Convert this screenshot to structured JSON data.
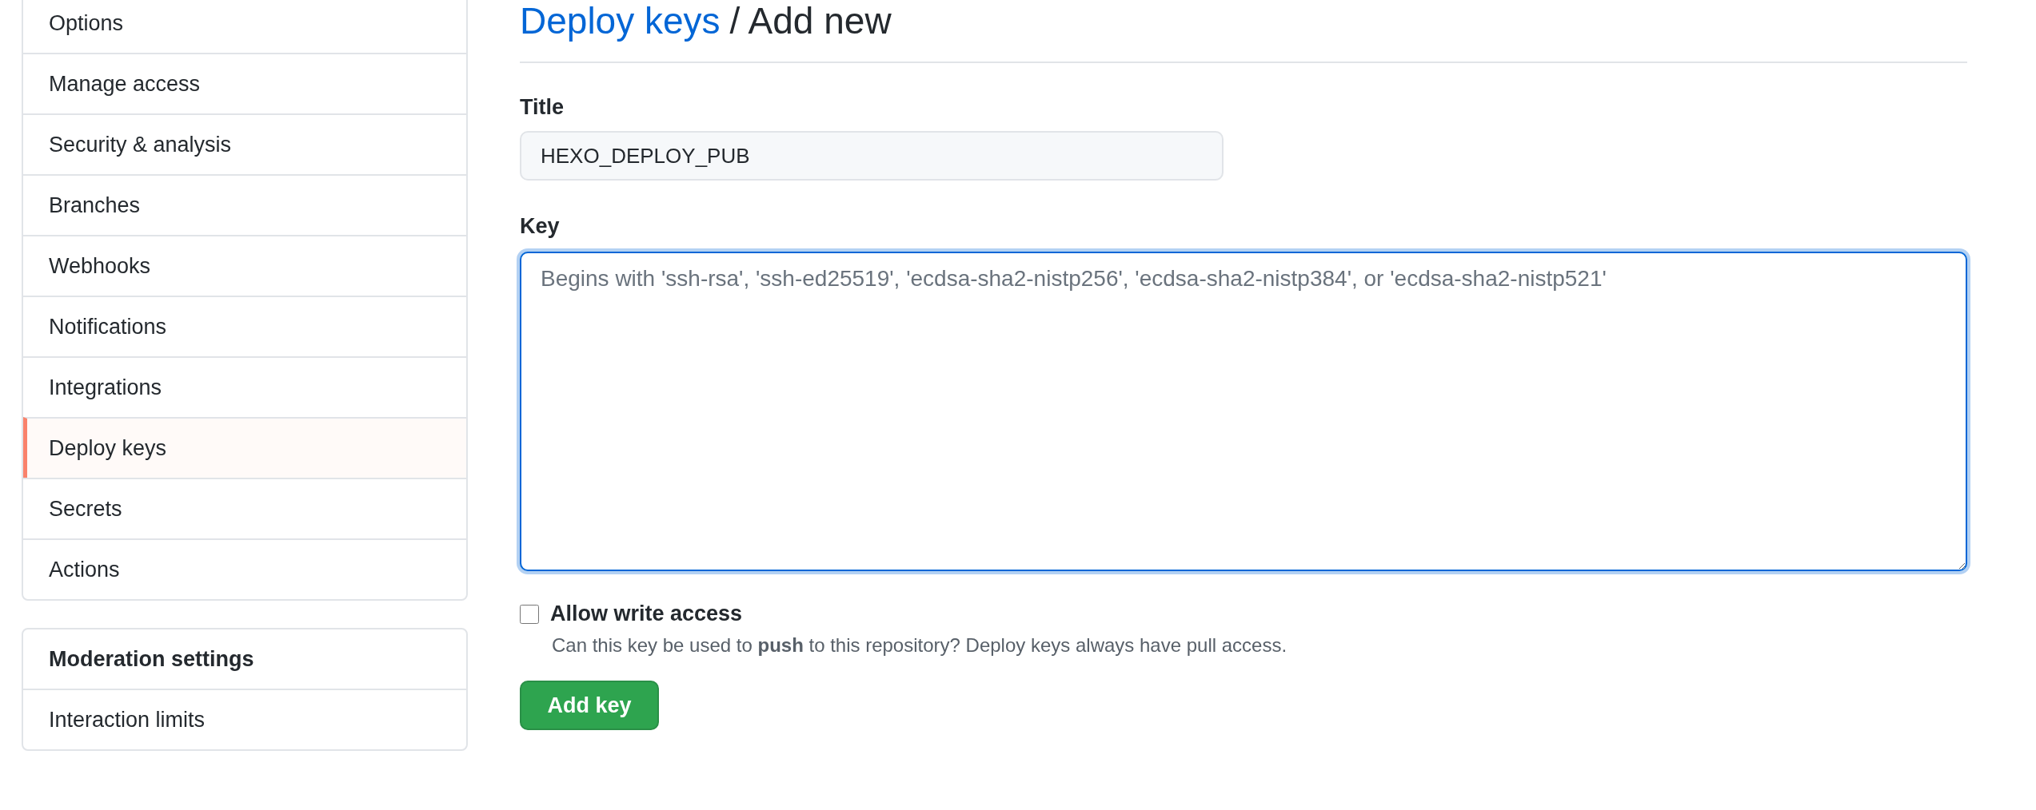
{
  "sidebar": {
    "items": [
      {
        "label": "Options",
        "selected": false
      },
      {
        "label": "Manage access",
        "selected": false
      },
      {
        "label": "Security & analysis",
        "selected": false
      },
      {
        "label": "Branches",
        "selected": false
      },
      {
        "label": "Webhooks",
        "selected": false
      },
      {
        "label": "Notifications",
        "selected": false
      },
      {
        "label": "Integrations",
        "selected": false
      },
      {
        "label": "Deploy keys",
        "selected": true
      },
      {
        "label": "Secrets",
        "selected": false
      },
      {
        "label": "Actions",
        "selected": false
      }
    ]
  },
  "moderation": {
    "heading": "Moderation settings",
    "items": [
      {
        "label": "Interaction limits",
        "selected": false
      }
    ]
  },
  "header": {
    "link": "Deploy keys",
    "rest": "/ Add new"
  },
  "title_field": {
    "label": "Title",
    "value": "HEXO_DEPLOY_PUB"
  },
  "key_field": {
    "label": "Key",
    "placeholder": "Begins with 'ssh-rsa', 'ssh-ed25519', 'ecdsa-sha2-nistp256', 'ecdsa-sha2-nistp384', or 'ecdsa-sha2-nistp521'",
    "focused": true
  },
  "write_access": {
    "label": "Allow write access",
    "checked": false,
    "note": "Can this key be used to **push** to this repository? Deploy keys always have pull access."
  },
  "button": "Add key"
}
